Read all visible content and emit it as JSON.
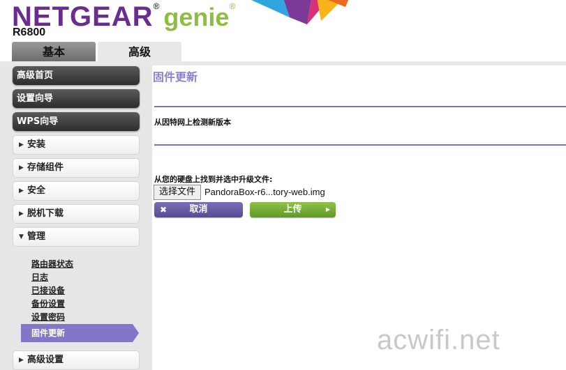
{
  "header": {
    "brand_netgear": "NETGEAR",
    "brand_genie": "genie",
    "reg_mark": "®",
    "model": "R6800",
    "tabs": [
      {
        "label": "基本"
      },
      {
        "label": "高级"
      }
    ],
    "logo_colors": [
      "#2fa6e0",
      "#7a3a96",
      "#d6317a",
      "#f7b21c",
      "#ea6a1f"
    ]
  },
  "sidebar": {
    "main_items": [
      {
        "label": "高级首页"
      },
      {
        "label": "设置向导"
      },
      {
        "label": "WPS向导"
      }
    ],
    "groups": [
      {
        "label": "安装",
        "arrow": "▶"
      },
      {
        "label": "存储组件",
        "arrow": "▶"
      },
      {
        "label": "安全",
        "arrow": "▶"
      },
      {
        "label": "脱机下载",
        "arrow": "▶"
      },
      {
        "label": "管理",
        "arrow": "▼"
      },
      {
        "label": "高级设置",
        "arrow": "▶"
      }
    ],
    "sub_items": [
      {
        "label": "路由器状态"
      },
      {
        "label": "日志"
      },
      {
        "label": "已接设备"
      },
      {
        "label": "备份设置"
      },
      {
        "label": "设置密码"
      }
    ],
    "active_sub": "固件更新"
  },
  "main": {
    "title": "固件更新",
    "check_online": "从因特网上检测新版本",
    "locate_file": "从您的硬盘上找到并选中升级文件:",
    "choose_file_button": "选择文件",
    "file_name": "PandoraBox-r6...tory-web.img",
    "cancel_button": "取消",
    "cancel_icon": "✖",
    "upload_button": "上传",
    "upload_icon": "▶"
  },
  "watermark": "acwifi.net"
}
